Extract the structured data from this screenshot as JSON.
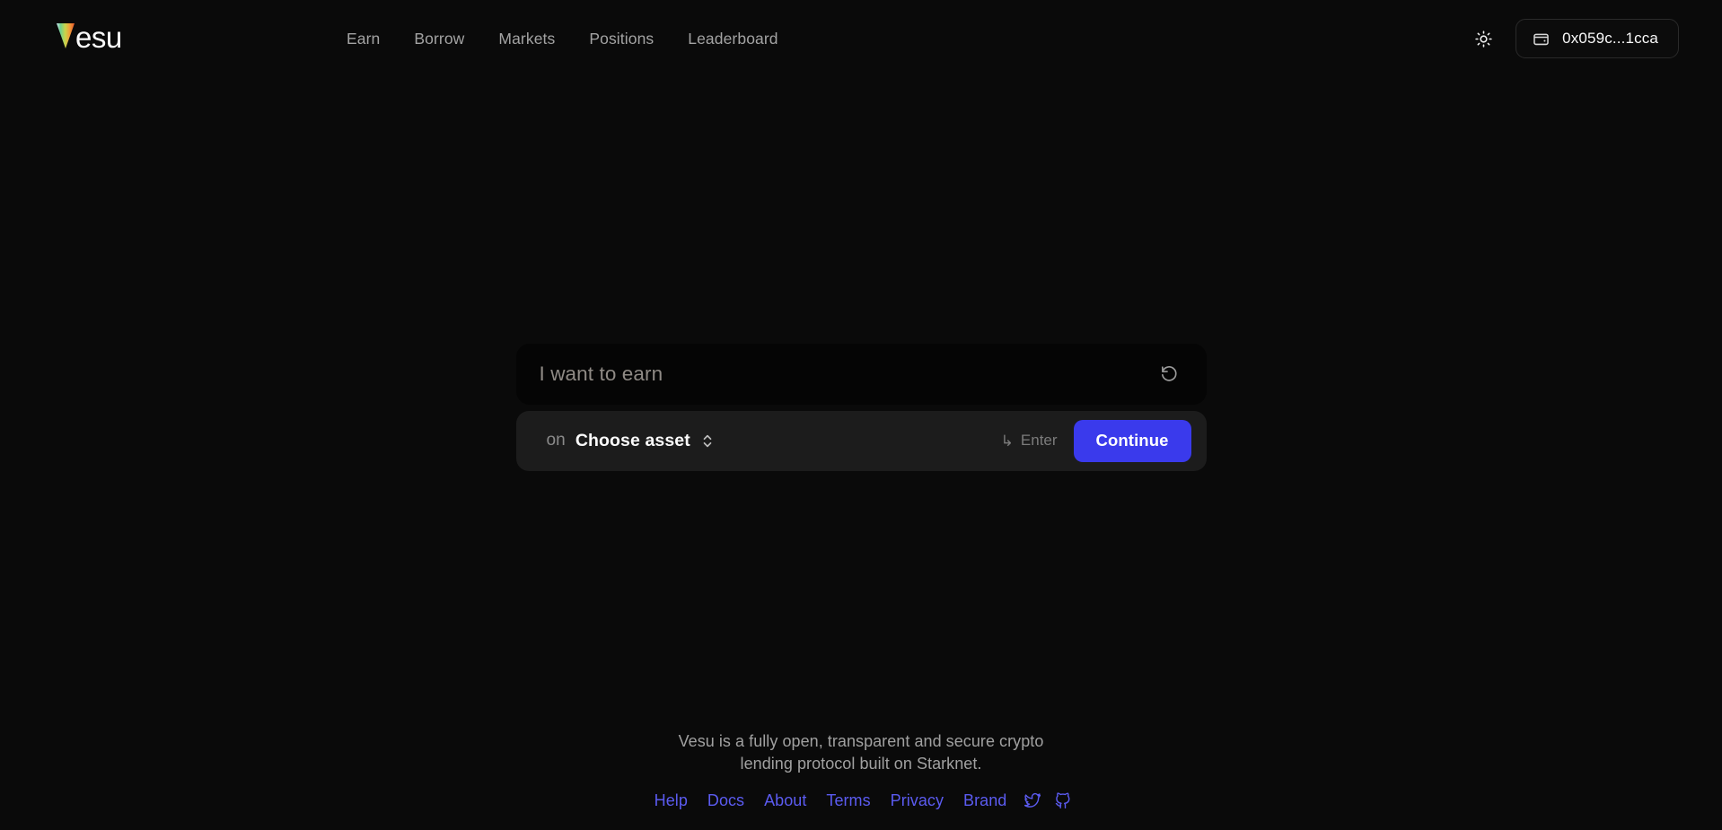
{
  "app": {
    "name": "Vesu",
    "logo_text": "vesu",
    "accent_color": "#3a3aec",
    "link_color": "#5b5bf0",
    "background_color": "#0a0a0a"
  },
  "header": {
    "nav_items": [
      {
        "label": "Earn",
        "name": "nav-earn"
      },
      {
        "label": "Borrow",
        "name": "nav-borrow"
      },
      {
        "label": "Markets",
        "name": "nav-markets"
      },
      {
        "label": "Positions",
        "name": "nav-positions"
      },
      {
        "label": "Leaderboard",
        "name": "nav-leaderboard"
      }
    ],
    "theme_toggle_icon": "sun-icon",
    "wallet": {
      "icon": "wallet-icon",
      "address": "0x059c...1cca"
    }
  },
  "composer": {
    "prompt": {
      "value": "",
      "placeholder": "I want to earn",
      "reset_icon": "rotate-ccw-icon"
    },
    "action": {
      "on_label": "on",
      "asset_label": "Choose asset",
      "asset_chevron_icon": "chevron-up-down-icon",
      "enter_hint_arrow": "↳",
      "enter_hint_label": "Enter",
      "continue_label": "Continue"
    }
  },
  "footer": {
    "tagline": "Vesu is a fully open, transparent and secure crypto lending protocol built on Starknet.",
    "links": [
      {
        "label": "Help",
        "name": "footer-link-help"
      },
      {
        "label": "Docs",
        "name": "footer-link-docs"
      },
      {
        "label": "About",
        "name": "footer-link-about"
      },
      {
        "label": "Terms",
        "name": "footer-link-terms"
      },
      {
        "label": "Privacy",
        "name": "footer-link-privacy"
      },
      {
        "label": "Brand",
        "name": "footer-link-brand"
      }
    ],
    "social": [
      {
        "icon": "twitter-icon",
        "name": "footer-social-twitter"
      },
      {
        "icon": "github-icon",
        "name": "footer-social-github"
      }
    ]
  }
}
